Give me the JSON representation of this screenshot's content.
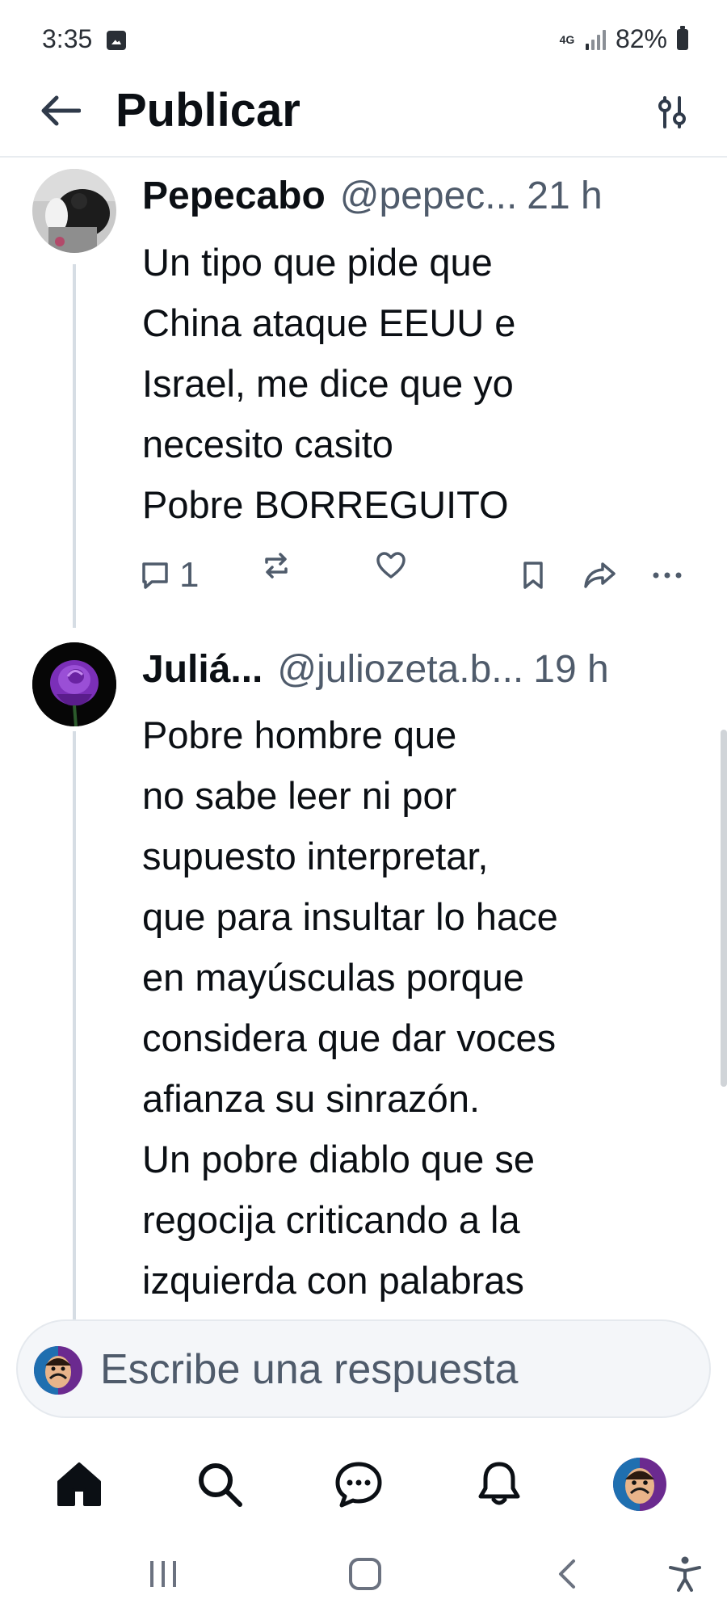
{
  "status_bar": {
    "time": "3:35",
    "network": "4G",
    "battery_percent": "82%",
    "signal_bars_lit": 1
  },
  "header": {
    "title": "Publicar",
    "back_icon": "arrow-left-icon",
    "filter_icon": "sliders-icon"
  },
  "posts": [
    {
      "author": "Pepecabo",
      "handle": "@pepec...",
      "time": "21 h",
      "text": "Un tipo que pide que\nChina ataque EEUU e\nIsrael, me dice que yo\nnecesito casito\nPobre BORREGUITO",
      "reply_count": "1",
      "avatar_icon": "photo-avatar"
    },
    {
      "author": "Juliá...",
      "handle": "@juliozeta.b...",
      "time": "19 h",
      "text": "Pobre hombre que\nno sabe leer ni por\nsupuesto interpretar,\nque para insultar lo hace\nen mayúsculas porque\nconsidera que dar voces\nafianza su sinrazón.\nUn pobre diablo que se\nregocija criticando a la\nizquierda con palabras",
      "avatar_icon": "purple-rose-avatar"
    }
  ],
  "reply_bar": {
    "placeholder": "Escribe una respuesta"
  },
  "bottom_nav": {
    "items": [
      "home-icon",
      "search-icon",
      "chat-icon",
      "bell-icon",
      "profile-avatar"
    ]
  },
  "system_nav": {
    "items": [
      "recents-icon",
      "home-circle-icon",
      "back-chevron-icon",
      "accessibility-icon"
    ]
  },
  "colors": {
    "text": "#0b0f14",
    "muted": "#4f5b6b",
    "thread_line": "#d6dde4",
    "divider": "#e8ecf0"
  }
}
